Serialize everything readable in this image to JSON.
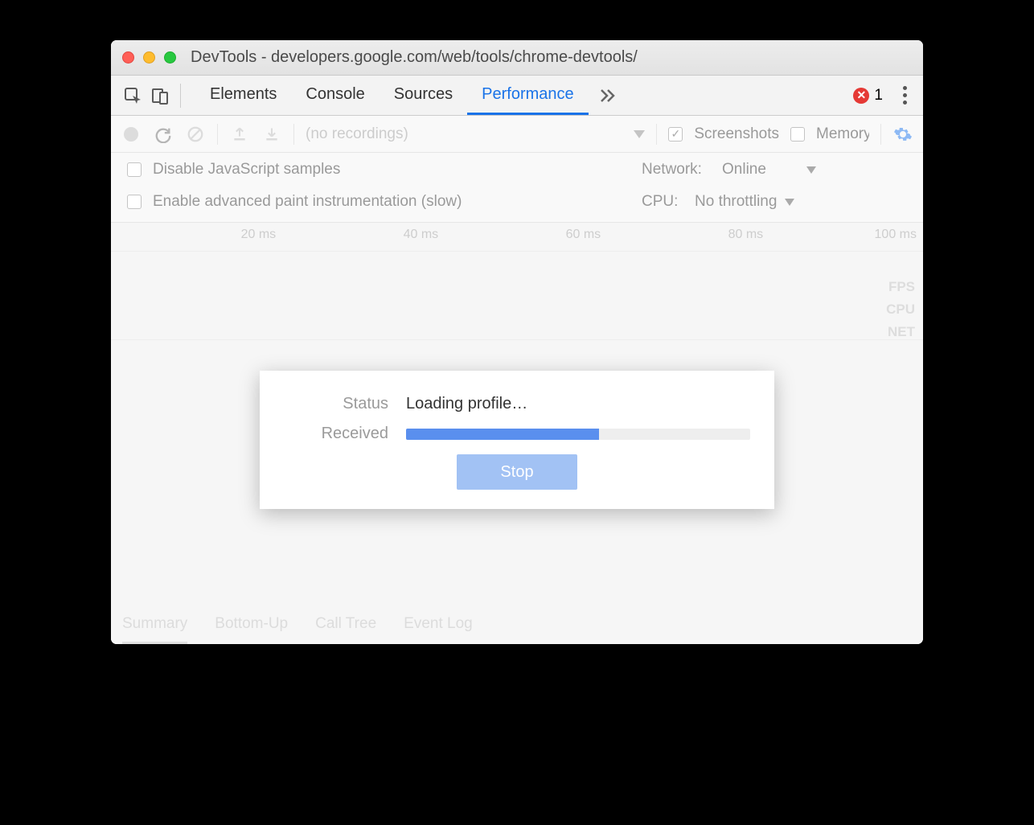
{
  "titlebar": {
    "title": "DevTools - developers.google.com/web/tools/chrome-devtools/"
  },
  "tabs": {
    "items": [
      "Elements",
      "Console",
      "Sources",
      "Performance"
    ],
    "active_index": 3,
    "error_count": "1"
  },
  "toolbar2": {
    "recordings_label": "(no recordings)",
    "screenshots_label": "Screenshots",
    "memory_label": "Memory"
  },
  "settings": {
    "disable_js_label": "Disable JavaScript samples",
    "enable_paint_label": "Enable advanced paint instrumentation (slow)",
    "network_label": "Network:",
    "network_value": "Online",
    "cpu_label": "CPU:",
    "cpu_value": "No throttling"
  },
  "ruler": {
    "ticks": [
      "20 ms",
      "40 ms",
      "60 ms",
      "80 ms",
      "100 ms"
    ],
    "lanes": [
      "FPS",
      "CPU",
      "NET"
    ]
  },
  "modal": {
    "status_label": "Status",
    "status_value": "Loading profile…",
    "received_label": "Received",
    "stop_label": "Stop",
    "progress_pct": 56
  },
  "bottom_tabs": [
    "Summary",
    "Bottom-Up",
    "Call Tree",
    "Event Log"
  ]
}
